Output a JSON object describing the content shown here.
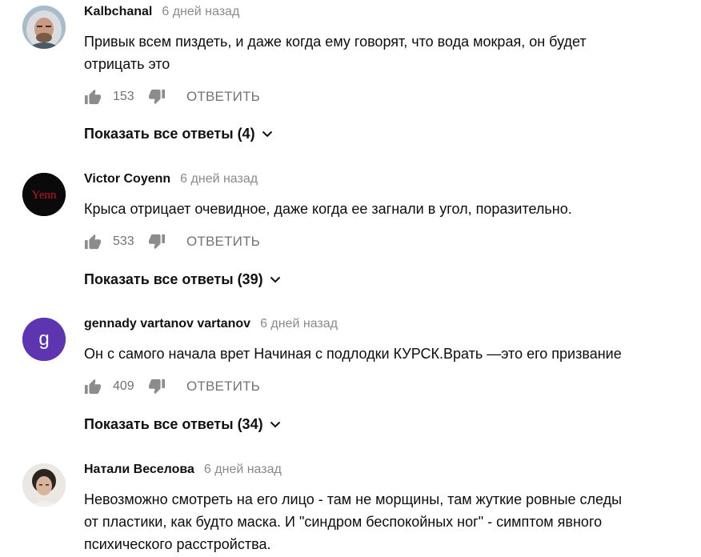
{
  "comments": [
    {
      "author": "Kalbchanal",
      "time": "6 дней назад",
      "lines": [
        "Привык всем пиздеть, и даже когда ему говорят, что вода мокрая, он будет",
        "отрицать это"
      ],
      "likes": "153",
      "reply_label": "ОТВЕТИТЬ",
      "show_replies": "Показать все ответы (4)",
      "avatar": {
        "kind": "photo",
        "icon": "portrait-man-fur-hood",
        "bg": "#9fb5c4"
      }
    },
    {
      "author": "Victor Coyenn",
      "time": "6 дней назад",
      "lines": [
        "Крыса отрицает очевидное, даже когда ее загнали в угол, поразительно."
      ],
      "likes": "533",
      "reply_label": "ОТВЕТИТЬ",
      "show_replies": "Показать все ответы (39)",
      "avatar": {
        "kind": "logo",
        "text": "Yenn",
        "bg": "#0a0a0a",
        "fg": "#c0142c"
      }
    },
    {
      "author": "gennady vartanov vartanov",
      "time": "6 дней назад",
      "lines": [
        "Он с самого начала врет Начиная с подлодки КУРСК.Врать —это его призвание"
      ],
      "likes": "409",
      "reply_label": "ОТВЕТИТЬ",
      "show_replies": "Показать все ответы (34)",
      "avatar": {
        "kind": "letter",
        "text": "g",
        "bg": "#5e35b1",
        "fg": "#ffffff"
      }
    },
    {
      "author": "Натали Веселова",
      "time": "6 дней назад",
      "lines": [
        "Невозможно смотреть на его лицо - там не морщины, там жуткие ровные следы",
        "от пластики, как будто маска. И \"синдром беспокойных ног\" - симптом явного",
        "психического расстройства."
      ],
      "avatar": {
        "kind": "photo",
        "icon": "portrait-woman-short-hair",
        "bg": "#e9e6e2"
      }
    }
  ],
  "colors": {
    "meta": "#8a8a8a",
    "action": "#737373",
    "text": "#0d0d0d"
  }
}
